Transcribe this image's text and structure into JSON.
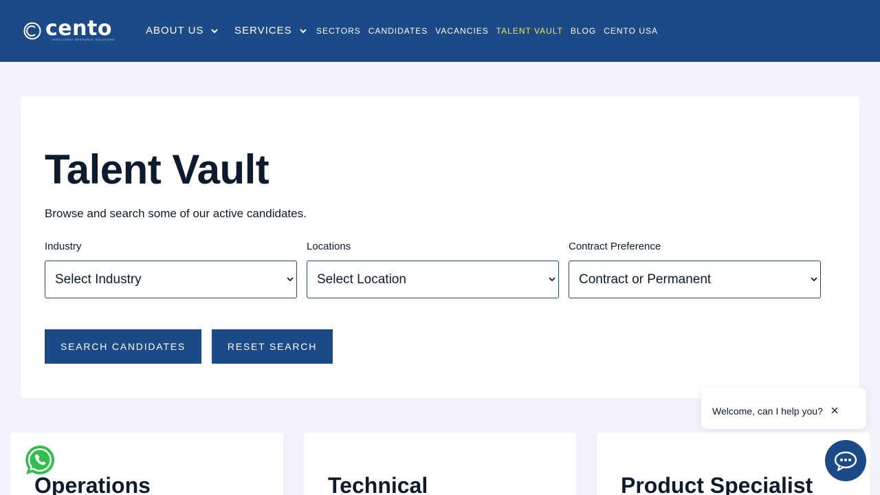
{
  "brand": {
    "logo_text": "cento",
    "tagline": "INTELLIGENT RESOURCE SOLUTIONS"
  },
  "nav": {
    "about": "ABOUT US",
    "services": "SERVICES",
    "links": [
      "SECTORS",
      "CANDIDATES",
      "VACANCIES",
      "TALENT VAULT",
      "BLOG",
      "CENTO USA"
    ],
    "active": "TALENT VAULT",
    "active_color": "#f2e85c"
  },
  "page": {
    "title": "Talent Vault",
    "subtitle": "Browse and search some of our active candidates."
  },
  "filters": {
    "industry_label": "Industry",
    "industry_value": "Select Industry",
    "location_label": "Locations",
    "location_value": "Select Location",
    "contract_label": "Contract Preference",
    "contract_value": "Contract or Permanent"
  },
  "buttons": {
    "search": "SEARCH CANDIDATES",
    "reset": "RESET SEARCH"
  },
  "candidates": [
    "Operations",
    "Technical",
    "Product Specialist"
  ],
  "chat": {
    "welcome": "Welcome, can I help you?"
  },
  "colors": {
    "primary": "#1c4a87",
    "background": "#f3f1fa",
    "text": "#0d1b2e"
  },
  "icons": {
    "chat": "chat-bubble-icon",
    "whatsapp": "whatsapp-icon",
    "close": "close-icon",
    "dropdown": "chevron-down-icon"
  }
}
